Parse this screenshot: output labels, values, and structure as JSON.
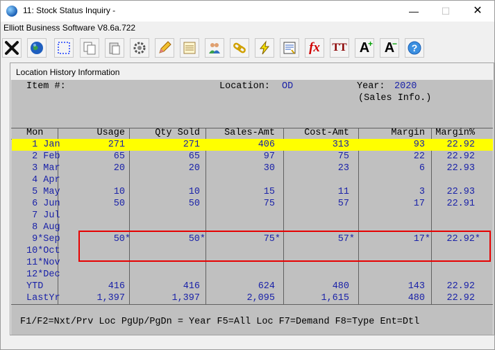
{
  "window": {
    "title": "11: Stock Status Inquiry -",
    "subtitle": "Elliott Business Software V8.6a.722",
    "min_glyph": "—",
    "max_glyph": "☐",
    "close_glyph": "✕"
  },
  "toolbar": {
    "icons": [
      "exit-icon",
      "globe-icon",
      "select-icon",
      "copy-icon",
      "paste-icon",
      "settings-icon",
      "edit-icon",
      "notes-icon",
      "users-icon",
      "link-icon",
      "lightning-icon",
      "report-icon",
      "function-icon",
      "font-icon",
      "font-increase-icon",
      "font-decrease-icon",
      "help-icon"
    ],
    "function_label": "fx",
    "font_label": "TT",
    "font_up_label": "A",
    "font_down_label": "A"
  },
  "panel": {
    "title": "Location History Information",
    "item_label": "Item #:",
    "location_label": "Location:",
    "location_value": "OD",
    "year_label": "Year:",
    "year_value": "2020",
    "info_note": "(Sales Info.)"
  },
  "table": {
    "headers": [
      "Mon",
      "Usage",
      "Qty Sold",
      "Sales-Amt",
      "Cost-Amt",
      "Margin",
      "Margin%"
    ],
    "rows": [
      {
        "mon": " 1 Jan",
        "usage": "271",
        "qty": "271",
        "sales": "406",
        "cost": "313",
        "margin": "93",
        "pct": "22.92"
      },
      {
        "mon": " 2 Feb",
        "usage": "65",
        "qty": "65",
        "sales": "97",
        "cost": "75",
        "margin": "22",
        "pct": "22.92"
      },
      {
        "mon": " 3 Mar",
        "usage": "20",
        "qty": "20",
        "sales": "30",
        "cost": "23",
        "margin": "6",
        "pct": "22.93"
      },
      {
        "mon": " 4 Apr",
        "usage": "",
        "qty": "",
        "sales": "",
        "cost": "",
        "margin": "",
        "pct": ""
      },
      {
        "mon": " 5 May",
        "usage": "10",
        "qty": "10",
        "sales": "15",
        "cost": "11",
        "margin": "3",
        "pct": "22.93"
      },
      {
        "mon": " 6 Jun",
        "usage": "50",
        "qty": "50",
        "sales": "75",
        "cost": "57",
        "margin": "17",
        "pct": "22.91"
      },
      {
        "mon": " 7 Jul",
        "usage": "",
        "qty": "",
        "sales": "",
        "cost": "",
        "margin": "",
        "pct": ""
      },
      {
        "mon": " 8 Aug",
        "usage": "",
        "qty": "",
        "sales": "",
        "cost": "",
        "margin": "",
        "pct": ""
      },
      {
        "mon": " 9*Sep",
        "usage": "50*",
        "qty": "50*",
        "sales": "75*",
        "cost": "57*",
        "margin": "17*",
        "pct": "22.92*"
      },
      {
        "mon": "10*Oct",
        "usage": "",
        "qty": "",
        "sales": "",
        "cost": "",
        "margin": "",
        "pct": ""
      },
      {
        "mon": "11*Nov",
        "usage": "",
        "qty": "",
        "sales": "",
        "cost": "",
        "margin": "",
        "pct": ""
      },
      {
        "mon": "12*Dec",
        "usage": "",
        "qty": "",
        "sales": "",
        "cost": "",
        "margin": "",
        "pct": ""
      },
      {
        "mon": "YTD",
        "usage": "416",
        "qty": "416",
        "sales": "624",
        "cost": "480",
        "margin": "143",
        "pct": "22.92"
      },
      {
        "mon": "LastYr",
        "usage": "1,397",
        "qty": "1,397",
        "sales": "2,095",
        "cost": "1,615",
        "margin": "480",
        "pct": "22.92"
      }
    ]
  },
  "footer": {
    "keys": "F1/F2=Nxt/Prv Loc PgUp/PgDn = Year F5=All Loc F7=Demand F8=Type Ent=Dtl"
  },
  "colors": {
    "highlight": "#ffff00",
    "value_text": "#1a22a8",
    "annotation_box": "#e60000",
    "screen_bg": "#c0c0c0"
  }
}
